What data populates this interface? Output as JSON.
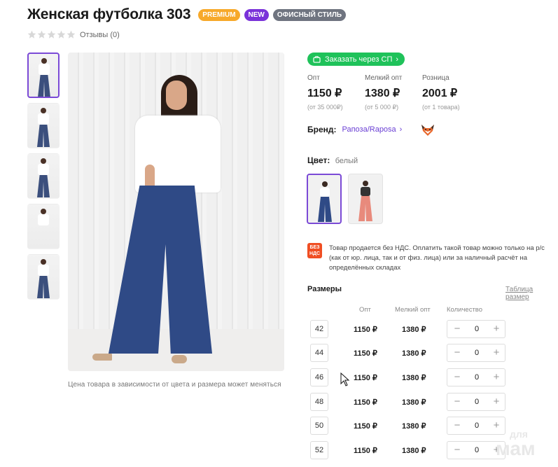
{
  "product": {
    "title": "Женская футболка 303",
    "badges": {
      "premium": "PREMIUM",
      "new": "NEW",
      "office": "ОФИСНЫЙ СТИЛЬ"
    },
    "reviews": "Отзывы (0)",
    "rating_stars": 0
  },
  "photo_caption": "Цена товара в зависимости от цвета и размера может меняться",
  "order_button": "Заказать через СП",
  "prices": [
    {
      "label": "Опт",
      "value": "1150 ₽",
      "note": "(от 35 000₽)"
    },
    {
      "label": "Мелкий опт",
      "value": "1380 ₽",
      "note": "(от 5 000 ₽)"
    },
    {
      "label": "Розница",
      "value": "2001 ₽",
      "note": "(от 1 товара)"
    }
  ],
  "brand": {
    "label": "Бренд:",
    "name": "Рапоза/Raposa"
  },
  "color": {
    "label": "Цвет:",
    "value": "белый"
  },
  "nds": {
    "icon_text": "БЕЗ НДС",
    "text": "Товар продается без НДС. Оплатить такой товар можно только на р/с (как от юр. лица, так и от физ. лица) или за наличный расчёт на определённых складах"
  },
  "sizes": {
    "title": "Размеры",
    "table_link": "Таблица размер",
    "headers": {
      "opt": "Опт",
      "small_opt": "Мелкий опт",
      "qty": "Количество"
    },
    "rows": [
      {
        "size": "42",
        "opt": "1150 ₽",
        "small_opt": "1380 ₽",
        "qty": "0"
      },
      {
        "size": "44",
        "opt": "1150 ₽",
        "small_opt": "1380 ₽",
        "qty": "0"
      },
      {
        "size": "46",
        "opt": "1150 ₽",
        "small_opt": "1380 ₽",
        "qty": "0"
      },
      {
        "size": "48",
        "opt": "1150 ₽",
        "small_opt": "1380 ₽",
        "qty": "0"
      },
      {
        "size": "50",
        "opt": "1150 ₽",
        "small_opt": "1380 ₽",
        "qty": "0"
      },
      {
        "size": "52",
        "opt": "1150 ₽",
        "small_opt": "1380 ₽",
        "qty": "0"
      }
    ],
    "minus": "−",
    "plus": "+"
  },
  "watermark": {
    "line1": "для",
    "line2": "мам"
  },
  "colors": {
    "accent": "#7b4ad6",
    "order_green": "#1fc25a",
    "premium": "#f7a92a",
    "new": "#7a32d9",
    "office": "#6f7480",
    "nds": "#f04e23"
  }
}
